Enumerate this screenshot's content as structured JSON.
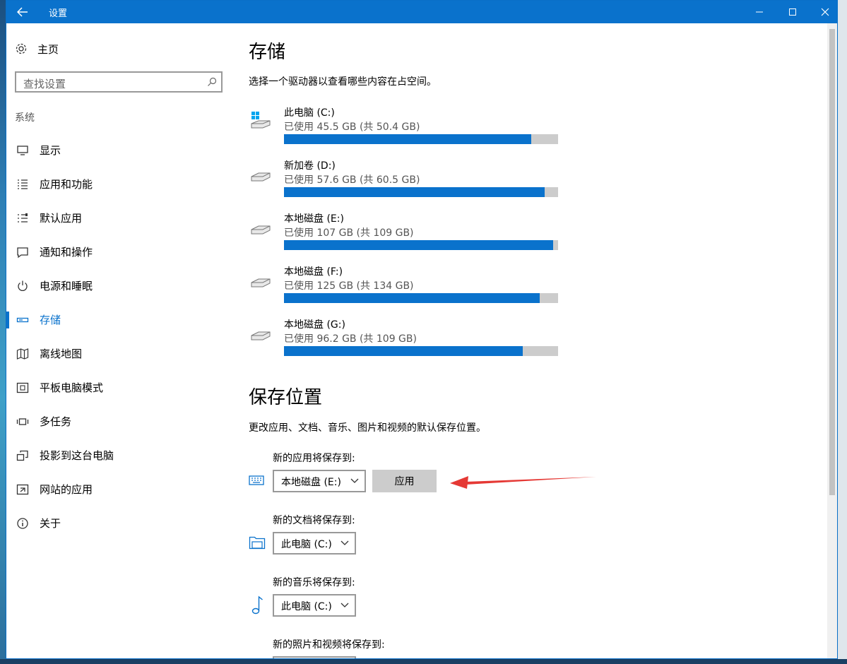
{
  "window": {
    "title": "设置"
  },
  "sidebar": {
    "home_label": "主页",
    "search_placeholder": "查找设置",
    "group_label": "系统",
    "items": [
      {
        "label": "显示",
        "icon": "monitor-icon"
      },
      {
        "label": "应用和功能",
        "icon": "list-icon"
      },
      {
        "label": "默认应用",
        "icon": "default-apps-icon"
      },
      {
        "label": "通知和操作",
        "icon": "notification-icon"
      },
      {
        "label": "电源和睡眠",
        "icon": "power-icon"
      },
      {
        "label": "存储",
        "icon": "storage-icon",
        "active": true
      },
      {
        "label": "离线地图",
        "icon": "map-icon"
      },
      {
        "label": "平板电脑模式",
        "icon": "tablet-icon"
      },
      {
        "label": "多任务",
        "icon": "multitask-icon"
      },
      {
        "label": "投影到这台电脑",
        "icon": "project-icon"
      },
      {
        "label": "网站的应用",
        "icon": "web-apps-icon"
      },
      {
        "label": "关于",
        "icon": "info-icon"
      }
    ]
  },
  "storage": {
    "title": "存储",
    "description": "选择一个驱动器以查看哪些内容在占空间。",
    "drives": [
      {
        "name": "此电脑 (C:)",
        "usage": "已使用 45.5 GB (共 50.4 GB)",
        "used_fraction": 0.903,
        "icon": "system-drive-icon"
      },
      {
        "name": "新加卷 (D:)",
        "usage": "已使用 57.6 GB (共 60.5 GB)",
        "used_fraction": 0.952,
        "icon": "drive-icon"
      },
      {
        "name": "本地磁盘 (E:)",
        "usage": "已使用 107 GB (共 109 GB)",
        "used_fraction": 0.982,
        "icon": "drive-icon"
      },
      {
        "name": "本地磁盘 (F:)",
        "usage": "已使用 125 GB (共 134 GB)",
        "used_fraction": 0.933,
        "icon": "drive-icon"
      },
      {
        "name": "本地磁盘 (G:)",
        "usage": "已使用 96.2 GB (共 109 GB)",
        "used_fraction": 0.871,
        "icon": "drive-icon"
      }
    ]
  },
  "save_locations": {
    "title": "保存位置",
    "description": "更改应用、文档、音乐、图片和视频的默认保存位置。",
    "apps": {
      "label": "新的应用将保存到:",
      "value": "本地磁盘 (E:)",
      "apply_label": "应用"
    },
    "documents": {
      "label": "新的文档将保存到:",
      "value": "此电脑 (C:)"
    },
    "music": {
      "label": "新的音乐将保存到:",
      "value": "此电脑 (C:)"
    },
    "photos": {
      "label": "新的照片和视频将保存到:"
    }
  },
  "colors": {
    "accent": "#0a72cc",
    "annotation_arrow": "#e53935",
    "bar_track": "#cccccc"
  }
}
